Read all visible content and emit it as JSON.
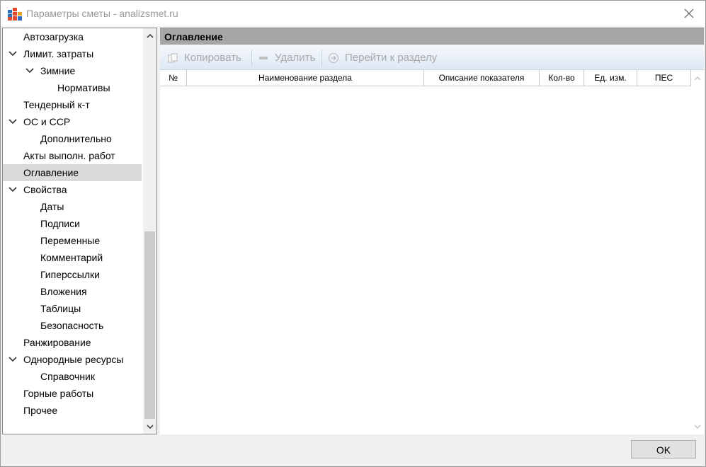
{
  "window": {
    "title": "Параметры сметы - analizsmet.ru",
    "app_icon": "grid-app-icon",
    "close_icon": "close-icon"
  },
  "tree": {
    "selected": "Оглавление",
    "items": [
      {
        "label": "Автозагрузка",
        "level": 0,
        "expander": "none"
      },
      {
        "label": "Лимит. затраты",
        "level": 0,
        "expander": "expanded"
      },
      {
        "label": "Зимние",
        "level": 1,
        "expander": "expanded"
      },
      {
        "label": "Нормативы",
        "level": 2,
        "expander": "none"
      },
      {
        "label": "Тендерный к-т",
        "level": 0,
        "expander": "none"
      },
      {
        "label": "ОС и ССР",
        "level": 0,
        "expander": "expanded"
      },
      {
        "label": "Дополнительно",
        "level": 1,
        "expander": "none"
      },
      {
        "label": "Акты выполн. работ",
        "level": 0,
        "expander": "none"
      },
      {
        "label": "Оглавление",
        "level": 0,
        "expander": "none"
      },
      {
        "label": "Свойства",
        "level": 0,
        "expander": "expanded"
      },
      {
        "label": "Даты",
        "level": 1,
        "expander": "none"
      },
      {
        "label": "Подписи",
        "level": 1,
        "expander": "none"
      },
      {
        "label": "Переменные",
        "level": 1,
        "expander": "none"
      },
      {
        "label": "Комментарий",
        "level": 1,
        "expander": "none"
      },
      {
        "label": "Гиперссылки",
        "level": 1,
        "expander": "none"
      },
      {
        "label": "Вложения",
        "level": 1,
        "expander": "none"
      },
      {
        "label": "Таблицы",
        "level": 1,
        "expander": "none"
      },
      {
        "label": "Безопасность",
        "level": 1,
        "expander": "none"
      },
      {
        "label": "Ранжирование",
        "level": 0,
        "expander": "none"
      },
      {
        "label": "Однородные ресурсы",
        "level": 0,
        "expander": "expanded"
      },
      {
        "label": "Справочник",
        "level": 1,
        "expander": "none"
      },
      {
        "label": "Горные работы",
        "level": 0,
        "expander": "none"
      },
      {
        "label": "Прочее",
        "level": 0,
        "expander": "none"
      }
    ]
  },
  "section": {
    "title": "Оглавление"
  },
  "toolbar": {
    "copy_label": "Копировать",
    "copy_icon": "copy-icon",
    "delete_label": "Удалить",
    "delete_icon": "minus-icon",
    "goto_label": "Перейти к разделу",
    "goto_icon": "arrow-right-circle-icon",
    "disabled_color": "#a8a8a8"
  },
  "table": {
    "columns": [
      "№",
      "Наименование раздела",
      "Описание показателя",
      "Кол-во",
      "Ед. изм.",
      "ПЕС"
    ],
    "rows": []
  },
  "footer": {
    "ok_label": "OK"
  },
  "colors": {
    "header_bg": "#a6a6a6",
    "selected_bg": "#dadada",
    "toolbar_gradient_top": "#f4f8fc",
    "toolbar_gradient_bottom": "#dde8f3"
  }
}
